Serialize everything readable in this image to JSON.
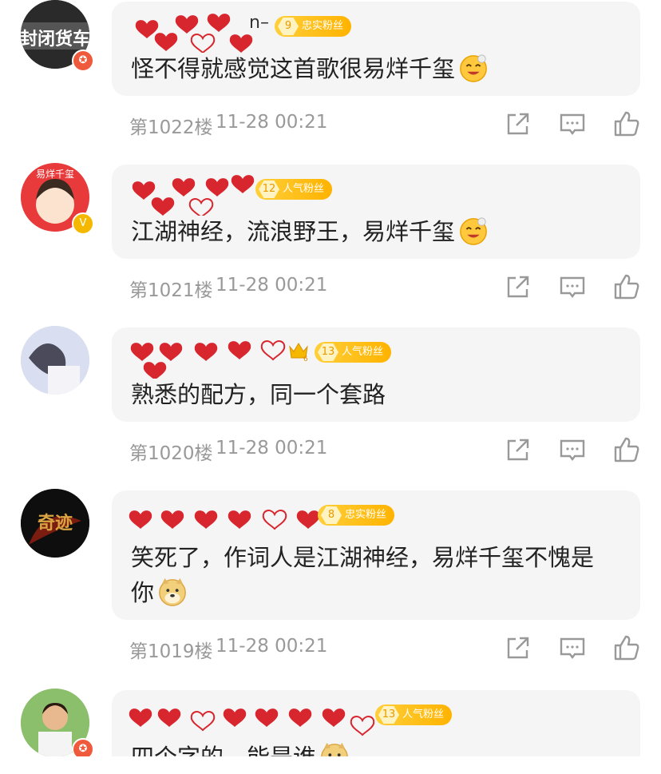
{
  "comments": [
    {
      "name_suffix": "n–",
      "avatar_text": "封闭货车",
      "avatar_badge": "✪",
      "avatar_badge_color": "#f05a3c",
      "fan_level": "9",
      "fan_label": "忠实粉丝",
      "text": "怪不得就感觉这首歌很易烊千玺",
      "emoji": "smiling-face-icon",
      "floor": "第1022楼",
      "time": "11-28 00:21"
    },
    {
      "name_suffix": "",
      "avatar_text": "易烊千玺",
      "avatar_badge": "V",
      "avatar_badge_color": "#f5b800",
      "fan_level": "12",
      "fan_label": "人气粉丝",
      "text": "江湖神经，流浪野王，易烊千玺",
      "emoji": "smiling-face-icon",
      "floor": "第1021楼",
      "time": "11-28 00:21"
    },
    {
      "name_suffix": "",
      "avatar_text": "",
      "avatar_badge": "",
      "avatar_badge_color": "",
      "crown_level": "6",
      "fan_level": "13",
      "fan_label": "人气粉丝",
      "text": "熟悉的配方，同一个套路",
      "emoji": "",
      "floor": "第1020楼",
      "time": "11-28 00:21"
    },
    {
      "name_suffix": "",
      "avatar_text": "奇迹",
      "avatar_badge": "",
      "avatar_badge_color": "",
      "fan_level": "8",
      "fan_label": "忠实粉丝",
      "text_line1": "笑死了，作词人是江湖神经，易烊千玺不愧是",
      "text_line2": "你",
      "emoji": "doge-icon",
      "floor": "第1019楼",
      "time": "11-28 00:21"
    },
    {
      "name_suffix": "",
      "avatar_text": "",
      "avatar_badge": "✪",
      "avatar_badge_color": "#f05a3c",
      "fan_level": "13",
      "fan_label": "人气粉丝",
      "text": "四个字的，能是谁",
      "emoji": "doge-icon",
      "floor": "",
      "time": ""
    }
  ],
  "icons": {
    "share": "share-icon",
    "reply": "comment-icon",
    "like": "thumbs-up-icon"
  },
  "colors": {
    "bubble": "#f5f5f5",
    "meta": "#999999",
    "fan_badge": "#ffb300",
    "heart": "#d8262f"
  }
}
